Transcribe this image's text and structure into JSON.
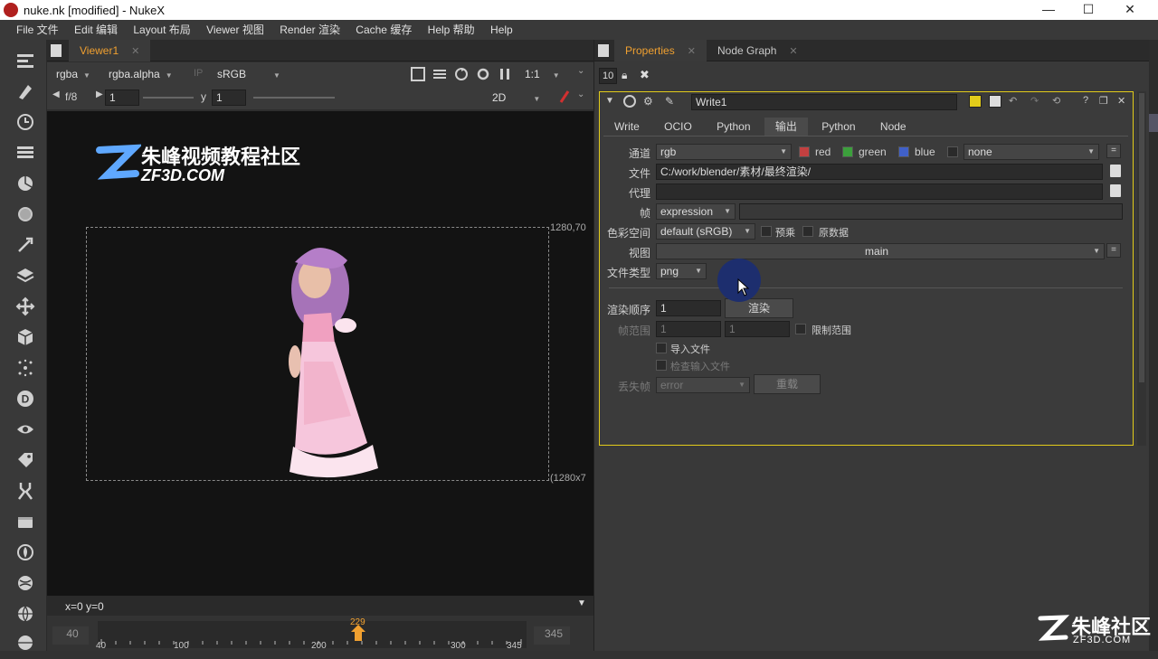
{
  "window": {
    "title": "nuke.nk [modified] - NukeX",
    "min": "—",
    "max": "☐",
    "close": "✕"
  },
  "menu": [
    "File 文件",
    "Edit 编辑",
    "Layout 布局",
    "Viewer 视图",
    "Render 渲染",
    "Cache 缓存",
    "Help 帮助",
    "Help"
  ],
  "viewer": {
    "tab": "Viewer1",
    "channels": "rgba",
    "alpha": "rgba.alpha",
    "ip": "IP",
    "lut": "sRGB",
    "zoom": "1:1",
    "fstop": "f/8",
    "gain": "1",
    "gamma_label": "y",
    "gamma": "1",
    "mode": "2D",
    "corner_tr": "1280,70",
    "corner_br": "(1280x7",
    "status": "x=0 y=0"
  },
  "watermark": {
    "cn": "朱峰视频教程社区",
    "en": "ZF3D.COM"
  },
  "timeline": {
    "start": "40",
    "end": "345",
    "current": "229",
    "ticks": [
      "40",
      "100",
      "200",
      "300",
      "345"
    ]
  },
  "props": {
    "tabs": [
      {
        "label": "Properties"
      },
      {
        "label": "Node Graph"
      }
    ],
    "max_panels": "10",
    "node_name": "Write1",
    "node_tabs": [
      "Write",
      "OCIO",
      "Python",
      "输出",
      "Python",
      "Node"
    ],
    "channels_label": "通道",
    "channels_value": "rgb",
    "ch_red": "red",
    "ch_green": "green",
    "ch_blue": "blue",
    "ch_none": "none",
    "file_label": "文件",
    "file_value": "C:/work/blender/素材/最终渲染/",
    "proxy_label": "代理",
    "frame_label": "帧",
    "frame_value": "expression",
    "colorspace_label": "色彩空间",
    "colorspace_value": "default (sRGB)",
    "premult_label": "预乘",
    "raw_label": "原数据",
    "views_label": "视图",
    "views_value": "main",
    "filetype_label": "文件类型",
    "filetype_value": "png",
    "render_order_label": "渲染顺序",
    "render_order_value": "1",
    "render_button": "渲染",
    "frame_range_label": "帧范围",
    "range_first": "1",
    "range_last": "1",
    "limit_range_label": "限制范围",
    "read_file_label": "导入文件",
    "check_input_label": "检查输入文件",
    "missing_label": "丢失帧",
    "missing_value": "error",
    "reload_button": "重载"
  },
  "corner_watermark": {
    "cn": "朱峰社区",
    "en": "ZF3D.COM"
  }
}
